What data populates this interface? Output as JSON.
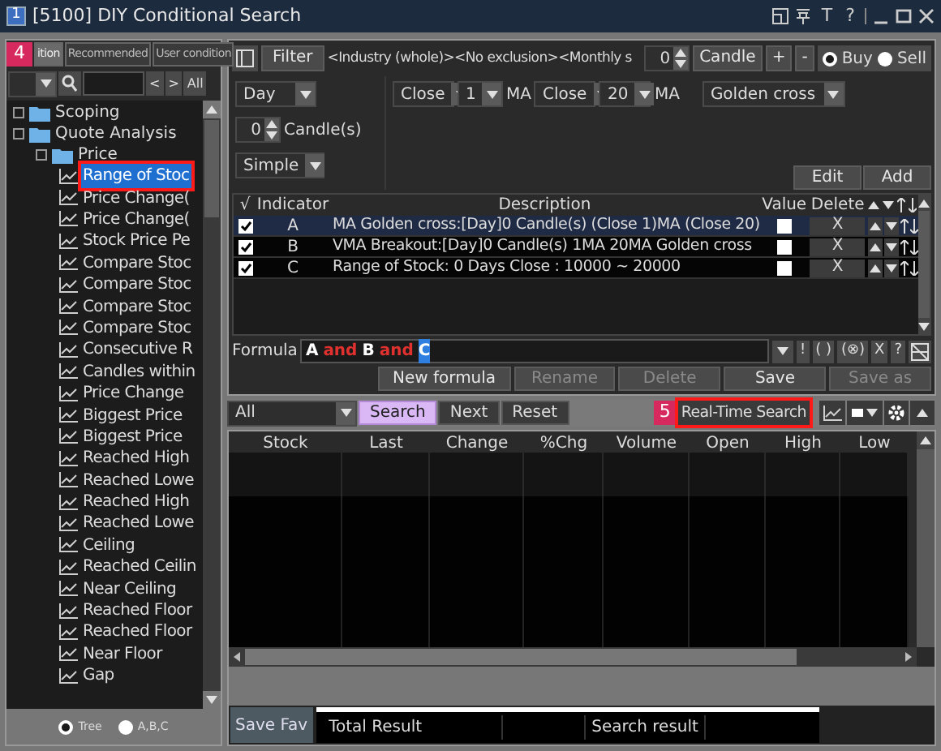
{
  "window": {
    "title": "[5100] DIY Conditional Search",
    "icon_label": "1",
    "text_buttons": [
      "T",
      "?"
    ]
  },
  "left_panel": {
    "callout": "4",
    "tabs": [
      {
        "label": "ition",
        "selected": true
      },
      {
        "label": "Recommended",
        "selected": false
      },
      {
        "label": "User condition",
        "selected": false
      }
    ],
    "nav_buttons": [
      "<",
      ">",
      "All"
    ],
    "tree": [
      {
        "kind": "folder",
        "label": "Scoping"
      },
      {
        "kind": "folder",
        "label": "Quote Analysis",
        "children": [
          {
            "kind": "folder",
            "label": "Price",
            "children": [
              {
                "kind": "item",
                "label": "Range of Stoc",
                "selected": true
              },
              {
                "kind": "item",
                "label": "Price Change(",
                "selected": false
              },
              {
                "kind": "item",
                "label": "Price Change(",
                "selected": false
              },
              {
                "kind": "item",
                "label": "Stock Price Pe",
                "selected": false
              },
              {
                "kind": "item",
                "label": "Compare Stoc",
                "selected": false
              },
              {
                "kind": "item",
                "label": "Compare Stoc",
                "selected": false
              },
              {
                "kind": "item",
                "label": "Compare Stoc",
                "selected": false
              },
              {
                "kind": "item",
                "label": "Compare Stoc",
                "selected": false
              },
              {
                "kind": "item",
                "label": "Consecutive R",
                "selected": false
              },
              {
                "kind": "item",
                "label": "Candles within",
                "selected": false
              },
              {
                "kind": "item",
                "label": "Price Change",
                "selected": false
              },
              {
                "kind": "item",
                "label": "Biggest Price",
                "selected": false
              },
              {
                "kind": "item",
                "label": "Biggest Price",
                "selected": false
              },
              {
                "kind": "item",
                "label": "Reached High",
                "selected": false
              },
              {
                "kind": "item",
                "label": "Reached Lowe",
                "selected": false
              },
              {
                "kind": "item",
                "label": "Reached High",
                "selected": false
              },
              {
                "kind": "item",
                "label": "Reached Lowe",
                "selected": false
              },
              {
                "kind": "item",
                "label": "Ceiling",
                "selected": false
              },
              {
                "kind": "item",
                "label": "Reached Ceilin",
                "selected": false
              },
              {
                "kind": "item",
                "label": "Near Ceiling",
                "selected": false
              },
              {
                "kind": "item",
                "label": "Reached Floor",
                "selected": false
              },
              {
                "kind": "item",
                "label": "Reached Floor",
                "selected": false
              },
              {
                "kind": "item",
                "label": "Near Floor",
                "selected": false
              },
              {
                "kind": "item",
                "label": "Gap",
                "selected": false
              }
            ]
          }
        ]
      }
    ],
    "view_options": [
      {
        "label": "Tree",
        "selected": true
      },
      {
        "label": "A,B,C",
        "selected": false
      }
    ]
  },
  "filter": {
    "button": "Filter",
    "summary": "<Industry (whole)><No exclusion><Monthly s",
    "count": "0",
    "candle_button": "Candle",
    "plus": "+",
    "minus": "-",
    "sides": [
      {
        "label": "Buy",
        "selected": true
      },
      {
        "label": "Sell",
        "selected": false
      }
    ]
  },
  "settings": {
    "period": "Day",
    "candles": "0",
    "candles_label": "Candle(s)",
    "average_type": "Simple",
    "price_1": "Close",
    "ma_1": "1",
    "ma_1_label": "MA",
    "price_2": "Close",
    "ma_2": "20",
    "ma_2_label": "MA",
    "signal": "Golden cross",
    "buttons": [
      "Edit",
      "Add"
    ]
  },
  "indicators": {
    "columns": [
      "√",
      "Indicator",
      "Description",
      "Value",
      "Delete"
    ],
    "rows": [
      {
        "checked": true,
        "indicator": "A",
        "description": "MA Golden cross:[Day]0 Candle(s) (Close 1)MA (Close 20)",
        "value_checked": false,
        "delete": "X",
        "selected": true
      },
      {
        "checked": true,
        "indicator": "B",
        "description": "VMA Breakout:[Day]0 Candle(s) 1MA 20MA Golden cross",
        "value_checked": false,
        "delete": "X",
        "selected": false
      },
      {
        "checked": true,
        "indicator": "C",
        "description": "Range of Stock: 0 Days Close : 10000 ~ 20000",
        "value_checked": false,
        "delete": "X",
        "selected": false
      }
    ]
  },
  "formula": {
    "label": "Formula",
    "tokens": [
      {
        "kind": "operand",
        "text": "A",
        "selected": false
      },
      {
        "kind": "operator",
        "text": "and",
        "selected": false
      },
      {
        "kind": "operand",
        "text": "B",
        "selected": false
      },
      {
        "kind": "operator",
        "text": "and",
        "selected": false
      },
      {
        "kind": "operand",
        "text": "C",
        "selected": true
      }
    ],
    "tools": [
      "!",
      "( )",
      "(⊗)",
      "X",
      "?"
    ]
  },
  "actions": [
    {
      "label": "New formula",
      "disabled": false
    },
    {
      "label": "Rename",
      "disabled": true
    },
    {
      "label": "Delete",
      "disabled": true
    },
    {
      "label": "Save",
      "disabled": false
    },
    {
      "label": "Save as",
      "disabled": true
    }
  ],
  "search_bar": {
    "scope": "All",
    "buttons": [
      {
        "label": "Search",
        "selected": true
      },
      {
        "label": "Next",
        "selected": false
      },
      {
        "label": "Reset",
        "selected": false
      }
    ],
    "callout": "5",
    "realtime": {
      "label": "Real-Time Search",
      "outlined": true
    }
  },
  "results": {
    "columns": [
      "Stock",
      "Last",
      "Change",
      "%Chg",
      "Volume",
      "Open",
      "High",
      "Low"
    ]
  },
  "footer": {
    "save_button": "Save Fav",
    "fields": [
      "Total Result",
      "Search result"
    ]
  }
}
